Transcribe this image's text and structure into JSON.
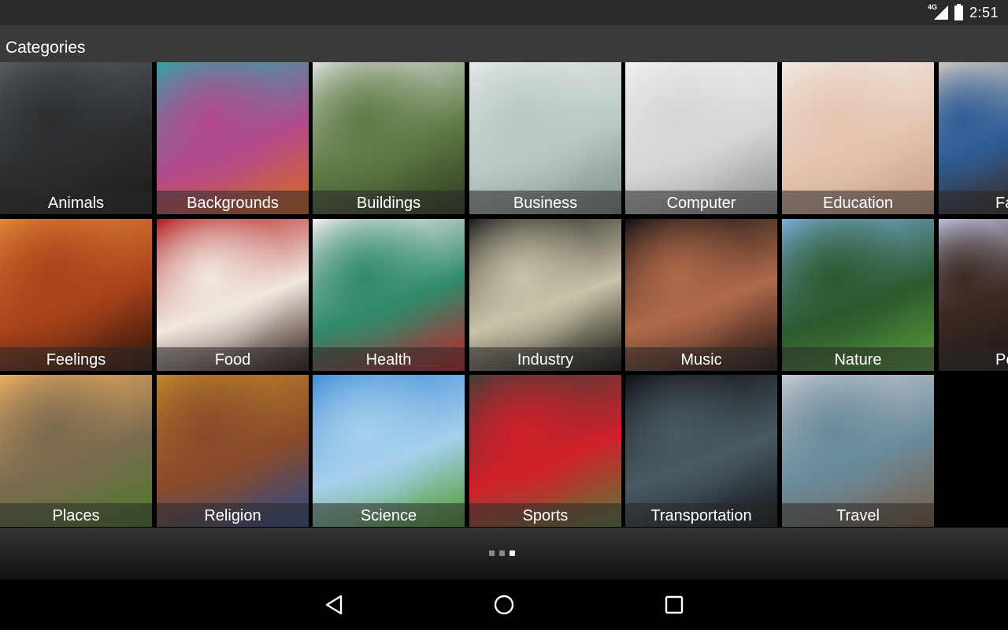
{
  "status_bar": {
    "network_label": "4G",
    "signal_icon": "cell-signal-icon",
    "battery_icon": "battery-full-icon",
    "time": "2:51"
  },
  "app_bar": {
    "title": "Categories"
  },
  "categories": [
    {
      "label": "Animals",
      "row": 0,
      "col": 0,
      "colors": [
        "#5a5e60",
        "#2c2e30",
        "#1a1b1c"
      ]
    },
    {
      "label": "Backgrounds",
      "row": 0,
      "col": 1,
      "colors": [
        "#2aa8a6",
        "#b34a8c",
        "#d96a1c"
      ]
    },
    {
      "label": "Buildings",
      "row": 0,
      "col": 2,
      "colors": [
        "#dfe3e2",
        "#5f7a44",
        "#2f3a22"
      ]
    },
    {
      "label": "Business",
      "row": 0,
      "col": 3,
      "colors": [
        "#e6ebe8",
        "#b9c8c2",
        "#7c8c86"
      ]
    },
    {
      "label": "Computer",
      "row": 0,
      "col": 4,
      "colors": [
        "#f2f2f2",
        "#d6d6d6",
        "#8d8d8d"
      ]
    },
    {
      "label": "Education",
      "row": 0,
      "col": 5,
      "colors": [
        "#f4ece6",
        "#e3c4b0",
        "#c79b86"
      ]
    },
    {
      "label": "Fashion",
      "row": 0,
      "col": 6,
      "colors": [
        "#c9c4be",
        "#2e5d96",
        "#3a2a22"
      ]
    },
    {
      "label": "Feelings",
      "row": 1,
      "col": 0,
      "colors": [
        "#e2883a",
        "#a8421a",
        "#2a1208"
      ]
    },
    {
      "label": "Food",
      "row": 1,
      "col": 1,
      "colors": [
        "#b01818",
        "#f1e8e0",
        "#2a1410"
      ]
    },
    {
      "label": "Health",
      "row": 1,
      "col": 2,
      "colors": [
        "#fbf2f4",
        "#2f8a6a",
        "#c4202a"
      ]
    },
    {
      "label": "Industry",
      "row": 1,
      "col": 3,
      "colors": [
        "#1a1a18",
        "#c9c3a8",
        "#0c0c0a"
      ]
    },
    {
      "label": "Music",
      "row": 1,
      "col": 4,
      "colors": [
        "#0f0f12",
        "#b06a4a",
        "#1c1010"
      ]
    },
    {
      "label": "Nature",
      "row": 1,
      "col": 5,
      "colors": [
        "#7fb0e0",
        "#2a5a2e",
        "#5a9a3a"
      ]
    },
    {
      "label": "People",
      "row": 1,
      "col": 6,
      "colors": [
        "#b9b9d6",
        "#3b2a22",
        "#1e1614"
      ]
    },
    {
      "label": "Places",
      "row": 2,
      "col": 0,
      "colors": [
        "#f0b060",
        "#7a6a50",
        "#4c7a2a"
      ]
    },
    {
      "label": "Religion",
      "row": 2,
      "col": 1,
      "colors": [
        "#c08a2a",
        "#8a4a2a",
        "#2a4a8a"
      ]
    },
    {
      "label": "Science",
      "row": 2,
      "col": 2,
      "colors": [
        "#3e8cd6",
        "#a6d0ec",
        "#4c9a2a"
      ]
    },
    {
      "label": "Sports",
      "row": 2,
      "col": 3,
      "colors": [
        "#3a4038",
        "#d0202a",
        "#5a7a3a"
      ]
    },
    {
      "label": "Transportation",
      "row": 2,
      "col": 4,
      "colors": [
        "#0c0e12",
        "#4a5a62",
        "#10141a"
      ]
    },
    {
      "label": "Travel",
      "row": 2,
      "col": 5,
      "colors": [
        "#c8ccd2",
        "#6a8a9a",
        "#7a5a40"
      ]
    }
  ],
  "pager": {
    "pages": 3,
    "current_page": 3
  },
  "nav_bar": {
    "back_icon": "back-triangle-icon",
    "home_icon": "home-circle-icon",
    "recents_icon": "recents-square-icon"
  }
}
